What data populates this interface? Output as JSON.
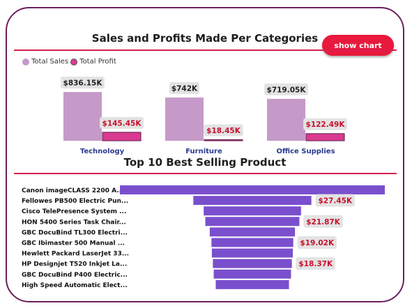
{
  "header": {
    "title": "Sales and Profits Made Per Categories",
    "show_chart_label": "show chart"
  },
  "legend": {
    "items": [
      {
        "label": "Total Sales",
        "color": "#c69ac8"
      },
      {
        "label": "Total Profit",
        "color": "#d93a8f"
      }
    ]
  },
  "funnel_section": {
    "title": "Top 10 Best Selling Product"
  },
  "colors": {
    "sales": "#c69ac8",
    "profit": "#d93a8f",
    "funnel": "#7a4fcd",
    "accent": "#e8193c",
    "border": "#6b1f5e",
    "category_label": "#2a3a8f",
    "value_label_bg": "#e3e3e3",
    "profit_label_text": "#c8102e"
  },
  "chart_data": [
    {
      "type": "bar",
      "title": "Sales and Profits Made Per Categories",
      "categories": [
        "Technology",
        "Furniture",
        "Office Supplies"
      ],
      "series": [
        {
          "name": "Total Sales",
          "values": [
            836.15,
            742,
            719.05
          ],
          "labels": [
            "$836.15K",
            "$742K",
            "$719.05K"
          ]
        },
        {
          "name": "Total Profit",
          "values": [
            145.45,
            18.45,
            122.49
          ],
          "labels": [
            "$145.45K",
            "$18.45K",
            "$122.49K"
          ]
        }
      ],
      "unit": "K",
      "legend": "top-left"
    },
    {
      "type": "bar",
      "orientation": "horizontal-funnel",
      "title": "Top 10 Best Selling Product",
      "categories": [
        "Canon imageCLASS 2200 A...",
        "Fellowes PB500 Electric Pun...",
        "Cisco TelePresence System ...",
        "HON 5400 Series Task Chair...",
        "GBC DocuBind TL300 Electri...",
        "GBC Ibimaster 500 Manual ...",
        "Hewlett Packard LaserJet 33...",
        "HP Designjet T520 Inkjet La...",
        "GBC DocuBind P400 Electric...",
        "High Speed Automatic Elect..."
      ],
      "values": [
        61.6,
        27.45,
        22.64,
        21.87,
        19.82,
        19.02,
        18.84,
        18.37,
        17.97,
        17.03
      ],
      "labels": [
        "",
        "$27.45K",
        "",
        "$21.87K",
        "",
        "$19.02K",
        "",
        "$18.37K",
        "",
        ""
      ],
      "unit": "K"
    }
  ]
}
